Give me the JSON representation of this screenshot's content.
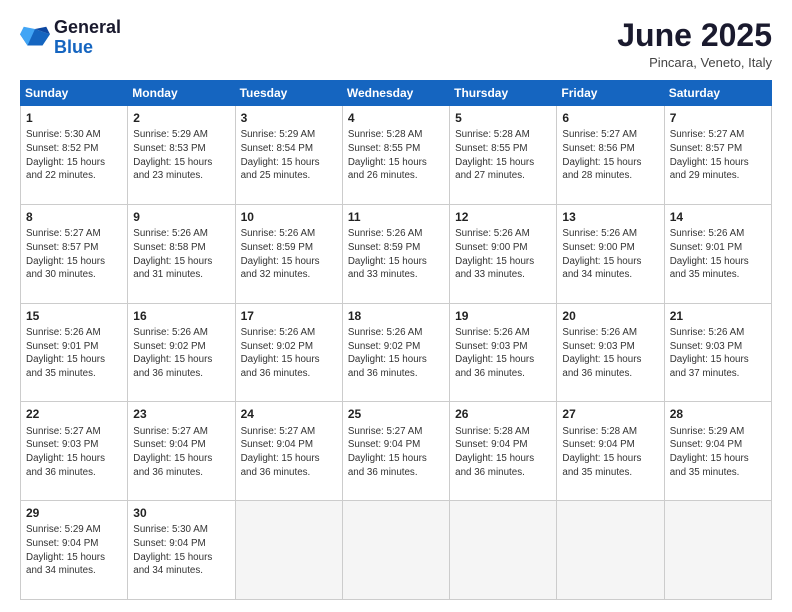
{
  "logo": {
    "general": "General",
    "blue": "Blue"
  },
  "title": "June 2025",
  "location": "Pincara, Veneto, Italy",
  "headers": [
    "Sunday",
    "Monday",
    "Tuesday",
    "Wednesday",
    "Thursday",
    "Friday",
    "Saturday"
  ],
  "weeks": [
    [
      {
        "day": "1",
        "sunrise": "5:30 AM",
        "sunset": "8:52 PM",
        "daylight": "15 hours and 22 minutes."
      },
      {
        "day": "2",
        "sunrise": "5:29 AM",
        "sunset": "8:53 PM",
        "daylight": "15 hours and 23 minutes."
      },
      {
        "day": "3",
        "sunrise": "5:29 AM",
        "sunset": "8:54 PM",
        "daylight": "15 hours and 25 minutes."
      },
      {
        "day": "4",
        "sunrise": "5:28 AM",
        "sunset": "8:55 PM",
        "daylight": "15 hours and 26 minutes."
      },
      {
        "day": "5",
        "sunrise": "5:28 AM",
        "sunset": "8:55 PM",
        "daylight": "15 hours and 27 minutes."
      },
      {
        "day": "6",
        "sunrise": "5:27 AM",
        "sunset": "8:56 PM",
        "daylight": "15 hours and 28 minutes."
      },
      {
        "day": "7",
        "sunrise": "5:27 AM",
        "sunset": "8:57 PM",
        "daylight": "15 hours and 29 minutes."
      }
    ],
    [
      {
        "day": "8",
        "sunrise": "5:27 AM",
        "sunset": "8:57 PM",
        "daylight": "15 hours and 30 minutes."
      },
      {
        "day": "9",
        "sunrise": "5:26 AM",
        "sunset": "8:58 PM",
        "daylight": "15 hours and 31 minutes."
      },
      {
        "day": "10",
        "sunrise": "5:26 AM",
        "sunset": "8:59 PM",
        "daylight": "15 hours and 32 minutes."
      },
      {
        "day": "11",
        "sunrise": "5:26 AM",
        "sunset": "8:59 PM",
        "daylight": "15 hours and 33 minutes."
      },
      {
        "day": "12",
        "sunrise": "5:26 AM",
        "sunset": "9:00 PM",
        "daylight": "15 hours and 33 minutes."
      },
      {
        "day": "13",
        "sunrise": "5:26 AM",
        "sunset": "9:00 PM",
        "daylight": "15 hours and 34 minutes."
      },
      {
        "day": "14",
        "sunrise": "5:26 AM",
        "sunset": "9:01 PM",
        "daylight": "15 hours and 35 minutes."
      }
    ],
    [
      {
        "day": "15",
        "sunrise": "5:26 AM",
        "sunset": "9:01 PM",
        "daylight": "15 hours and 35 minutes."
      },
      {
        "day": "16",
        "sunrise": "5:26 AM",
        "sunset": "9:02 PM",
        "daylight": "15 hours and 36 minutes."
      },
      {
        "day": "17",
        "sunrise": "5:26 AM",
        "sunset": "9:02 PM",
        "daylight": "15 hours and 36 minutes."
      },
      {
        "day": "18",
        "sunrise": "5:26 AM",
        "sunset": "9:02 PM",
        "daylight": "15 hours and 36 minutes."
      },
      {
        "day": "19",
        "sunrise": "5:26 AM",
        "sunset": "9:03 PM",
        "daylight": "15 hours and 36 minutes."
      },
      {
        "day": "20",
        "sunrise": "5:26 AM",
        "sunset": "9:03 PM",
        "daylight": "15 hours and 36 minutes."
      },
      {
        "day": "21",
        "sunrise": "5:26 AM",
        "sunset": "9:03 PM",
        "daylight": "15 hours and 37 minutes."
      }
    ],
    [
      {
        "day": "22",
        "sunrise": "5:27 AM",
        "sunset": "9:03 PM",
        "daylight": "15 hours and 36 minutes."
      },
      {
        "day": "23",
        "sunrise": "5:27 AM",
        "sunset": "9:04 PM",
        "daylight": "15 hours and 36 minutes."
      },
      {
        "day": "24",
        "sunrise": "5:27 AM",
        "sunset": "9:04 PM",
        "daylight": "15 hours and 36 minutes."
      },
      {
        "day": "25",
        "sunrise": "5:27 AM",
        "sunset": "9:04 PM",
        "daylight": "15 hours and 36 minutes."
      },
      {
        "day": "26",
        "sunrise": "5:28 AM",
        "sunset": "9:04 PM",
        "daylight": "15 hours and 36 minutes."
      },
      {
        "day": "27",
        "sunrise": "5:28 AM",
        "sunset": "9:04 PM",
        "daylight": "15 hours and 35 minutes."
      },
      {
        "day": "28",
        "sunrise": "5:29 AM",
        "sunset": "9:04 PM",
        "daylight": "15 hours and 35 minutes."
      }
    ],
    [
      {
        "day": "29",
        "sunrise": "5:29 AM",
        "sunset": "9:04 PM",
        "daylight": "15 hours and 34 minutes."
      },
      {
        "day": "30",
        "sunrise": "5:30 AM",
        "sunset": "9:04 PM",
        "daylight": "15 hours and 34 minutes."
      },
      null,
      null,
      null,
      null,
      null
    ]
  ]
}
